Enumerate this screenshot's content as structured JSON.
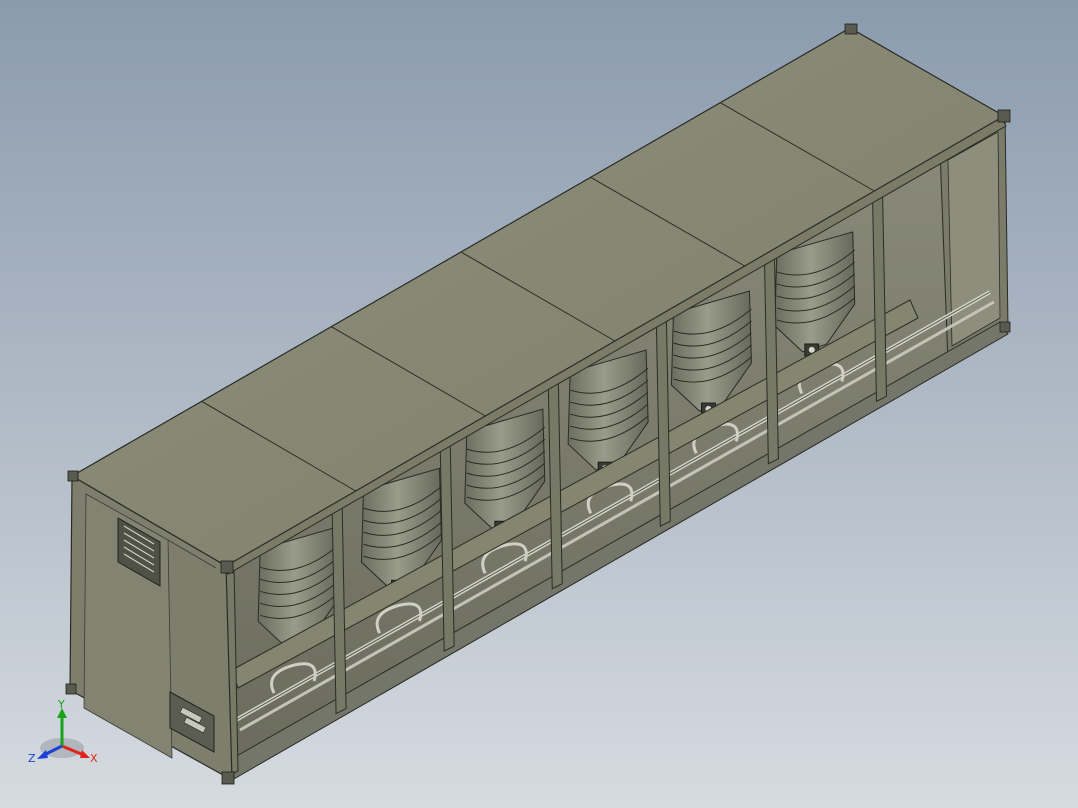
{
  "triad": {
    "x_label": "X",
    "y_label": "Y",
    "z_label": "Z"
  },
  "colors": {
    "background_top": "#8b9bae",
    "background_bottom": "#d6dbe1",
    "container_face_left": "#7d7f6c",
    "container_face_roof": "#8a8c77",
    "container_interior": "#6d6f5e",
    "edge_line": "#2b2b26",
    "axis_x": "#e0241b",
    "axis_y": "#1ba21b",
    "axis_z": "#1b3fd8"
  },
  "model": {
    "roof_panel_count": 6,
    "side_bay_count": 6,
    "tank_count": 6
  }
}
